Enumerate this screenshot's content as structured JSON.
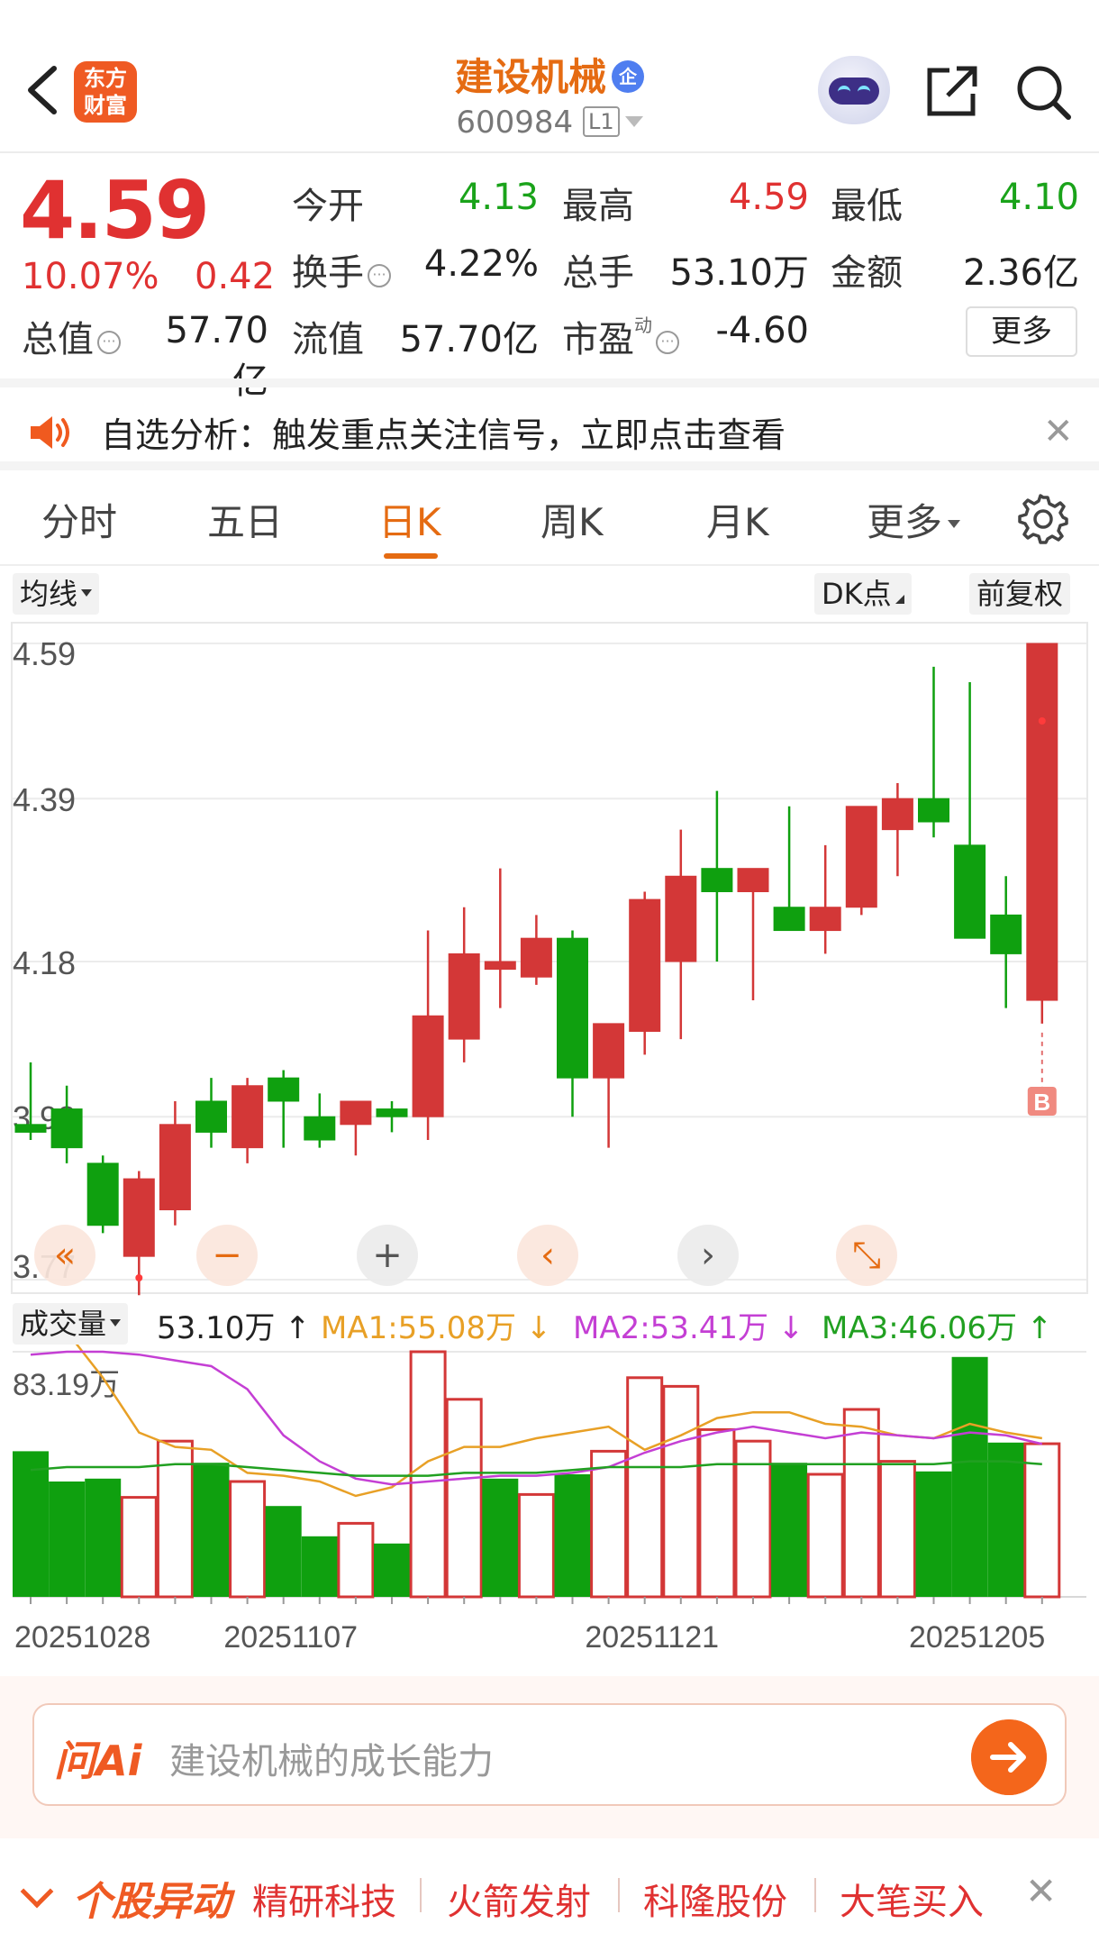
{
  "header": {
    "app_logo_text": "东方财富",
    "stock_name": "建设机械",
    "name_badge": "企",
    "stock_code": "600984",
    "level_badge": "L1"
  },
  "quote": {
    "price": "4.59",
    "change_pct": "10.07%",
    "change_amt": "0.42",
    "fields": [
      {
        "label": "今开",
        "value": "4.13",
        "color": "green"
      },
      {
        "label": "最高",
        "value": "4.59",
        "color": "red"
      },
      {
        "label": "最低",
        "value": "4.10",
        "color": "green"
      },
      {
        "label": "换手",
        "value": "4.22%",
        "color": "black"
      },
      {
        "label": "总手",
        "value": "53.10万",
        "color": "black"
      },
      {
        "label": "金额",
        "value": "2.36亿",
        "color": "black"
      },
      {
        "label": "总值",
        "value": "57.70亿",
        "color": "black"
      },
      {
        "label": "流值",
        "value": "57.70亿",
        "color": "black"
      },
      {
        "label": "市盈",
        "value": "-4.60",
        "color": "black"
      }
    ],
    "pe_superscript": "动",
    "more_label": "更多"
  },
  "notice": {
    "text": "自选分析：触发重点关注信号，立即点击查看",
    "close": "✕"
  },
  "tabs": [
    {
      "label": "分时"
    },
    {
      "label": "五日"
    },
    {
      "label": "日K",
      "active": true
    },
    {
      "label": "周K"
    },
    {
      "label": "月K"
    },
    {
      "label": "更多"
    }
  ],
  "chart_toolbar": {
    "ma_select": "均线",
    "dk_point": "DK点",
    "adjust": "前复权"
  },
  "chart_data": {
    "type": "candlestick",
    "y_ticks": [
      "4.59",
      "4.39",
      "4.18",
      "3.98",
      "3.77"
    ],
    "ylim": [
      3.77,
      4.59
    ],
    "x_tick_labels": [
      "20251028",
      "20251107",
      "20251121",
      "20251205"
    ],
    "marker": "B",
    "candles": [
      {
        "o": 3.97,
        "h": 4.05,
        "l": 3.95,
        "c": 3.96
      },
      {
        "o": 3.99,
        "h": 4.02,
        "l": 3.92,
        "c": 3.94
      },
      {
        "o": 3.92,
        "h": 3.93,
        "l": 3.83,
        "c": 3.84
      },
      {
        "o": 3.8,
        "h": 3.91,
        "l": 3.75,
        "c": 3.9
      },
      {
        "o": 3.86,
        "h": 4.0,
        "l": 3.84,
        "c": 3.97
      },
      {
        "o": 4.0,
        "h": 4.03,
        "l": 3.94,
        "c": 3.96
      },
      {
        "o": 3.94,
        "h": 4.03,
        "l": 3.92,
        "c": 4.02
      },
      {
        "o": 4.03,
        "h": 4.04,
        "l": 3.94,
        "c": 4.0
      },
      {
        "o": 3.98,
        "h": 4.01,
        "l": 3.94,
        "c": 3.95
      },
      {
        "o": 3.97,
        "h": 3.99,
        "l": 3.93,
        "c": 4.0
      },
      {
        "o": 3.99,
        "h": 4.0,
        "l": 3.96,
        "c": 3.98
      },
      {
        "o": 3.98,
        "h": 4.22,
        "l": 3.95,
        "c": 4.11
      },
      {
        "o": 4.08,
        "h": 4.25,
        "l": 4.05,
        "c": 4.19
      },
      {
        "o": 4.17,
        "h": 4.3,
        "l": 4.12,
        "c": 4.18
      },
      {
        "o": 4.16,
        "h": 4.24,
        "l": 4.15,
        "c": 4.21
      },
      {
        "o": 4.21,
        "h": 4.22,
        "l": 3.98,
        "c": 4.03
      },
      {
        "o": 4.03,
        "h": 4.1,
        "l": 3.94,
        "c": 4.1
      },
      {
        "o": 4.09,
        "h": 4.27,
        "l": 4.06,
        "c": 4.26
      },
      {
        "o": 4.18,
        "h": 4.35,
        "l": 4.08,
        "c": 4.29
      },
      {
        "o": 4.3,
        "h": 4.4,
        "l": 4.18,
        "c": 4.27
      },
      {
        "o": 4.27,
        "h": 4.3,
        "l": 4.13,
        "c": 4.3
      },
      {
        "o": 4.25,
        "h": 4.38,
        "l": 4.22,
        "c": 4.22
      },
      {
        "o": 4.22,
        "h": 4.33,
        "l": 4.19,
        "c": 4.25
      },
      {
        "o": 4.25,
        "h": 4.38,
        "l": 4.24,
        "c": 4.38
      },
      {
        "o": 4.35,
        "h": 4.41,
        "l": 4.29,
        "c": 4.39
      },
      {
        "o": 4.39,
        "h": 4.56,
        "l": 4.34,
        "c": 4.36
      },
      {
        "o": 4.33,
        "h": 4.54,
        "l": 4.24,
        "c": 4.21
      },
      {
        "o": 4.24,
        "h": 4.29,
        "l": 4.12,
        "c": 4.19
      },
      {
        "o": 4.13,
        "h": 4.59,
        "l": 4.1,
        "c": 4.59
      }
    ]
  },
  "volume": {
    "selector": "成交量",
    "vol_text": "53.10万",
    "vol_arrow": "↑",
    "ma1_text": "MA1:55.08万",
    "ma1_arrow": "↓",
    "ma2_text": "MA2:53.41万",
    "ma2_arrow": "↓",
    "ma3_text": "MA3:46.06万",
    "ma3_arrow": "↑",
    "y_label": "83.19万",
    "colors": {
      "ma1": "#e8a026",
      "ma2": "#c43fd4",
      "ma3": "#21a021",
      "up": "#d33737",
      "down": "#0fa00f"
    },
    "bars": [
      {
        "v": 50.5,
        "up": false
      },
      {
        "v": 40.0,
        "up": false
      },
      {
        "v": 41.0,
        "up": false
      },
      {
        "v": 34.5,
        "up": true
      },
      {
        "v": 54.0,
        "up": true
      },
      {
        "v": 46.5,
        "up": false
      },
      {
        "v": 40.0,
        "up": true
      },
      {
        "v": 31.5,
        "up": false
      },
      {
        "v": 21.0,
        "up": false
      },
      {
        "v": 25.5,
        "up": true
      },
      {
        "v": 18.5,
        "up": false
      },
      {
        "v": 85.0,
        "up": true
      },
      {
        "v": 68.5,
        "up": true
      },
      {
        "v": 41.0,
        "up": false
      },
      {
        "v": 35.5,
        "up": true
      },
      {
        "v": 42.5,
        "up": false
      },
      {
        "v": 50.5,
        "up": true
      },
      {
        "v": 76.0,
        "up": true
      },
      {
        "v": 73.0,
        "up": true
      },
      {
        "v": 58.0,
        "up": true
      },
      {
        "v": 54.0,
        "up": true
      },
      {
        "v": 46.5,
        "up": false
      },
      {
        "v": 42.5,
        "up": true
      },
      {
        "v": 65.0,
        "up": true
      },
      {
        "v": 47.0,
        "up": true
      },
      {
        "v": 43.5,
        "up": false
      },
      {
        "v": 83.19,
        "up": false
      },
      {
        "v": 53.5,
        "up": false
      },
      {
        "v": 53.1,
        "up": true
      }
    ],
    "ma1": [
      100,
      92,
      76,
      57,
      52,
      51,
      43,
      42,
      40,
      35,
      38,
      47,
      52,
      52,
      55,
      57,
      59,
      51,
      56,
      62,
      64,
      64,
      60,
      59,
      56,
      55,
      60,
      57,
      55
    ],
    "ma2": [
      84,
      85,
      85,
      84,
      82,
      80,
      72,
      56,
      47,
      41,
      39,
      40,
      41,
      42,
      42,
      43,
      45,
      50,
      54,
      57,
      59,
      57,
      55,
      57,
      56,
      55,
      57,
      56,
      53
    ],
    "ma3": [
      44,
      45,
      45,
      45,
      46,
      46,
      45,
      44,
      43,
      42,
      42,
      42,
      43,
      43,
      43,
      44,
      45,
      45,
      45,
      46,
      46,
      46,
      46,
      46,
      46,
      46,
      47,
      47,
      46
    ]
  },
  "chart_controls": [
    "«",
    "−",
    "+",
    "‹",
    "›",
    "⤡"
  ],
  "ai": {
    "logo": "问Ai",
    "placeholder": "建设机械的成长能力"
  },
  "ticker": {
    "title": "个股异动",
    "items": [
      "精研科技",
      "火箭发射",
      "科隆股份",
      "大笔买入"
    ],
    "close": "✕"
  }
}
